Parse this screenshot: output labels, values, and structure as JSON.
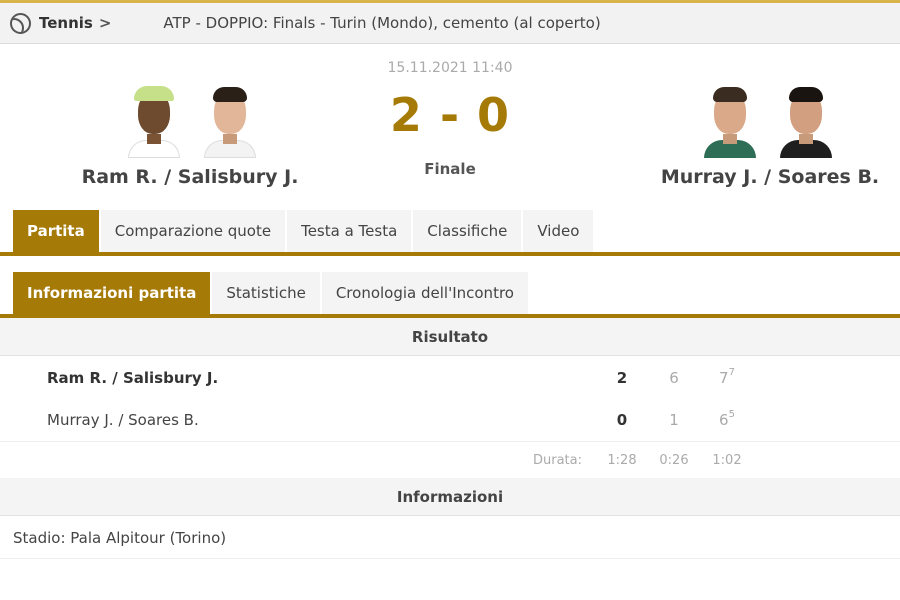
{
  "breadcrumb": {
    "sport": "Tennis",
    "separator": ">",
    "competition": "ATP - DOPPIO: Finals - Turin (Mondo), cemento (al coperto)",
    "sport_icon": "tennis-ball-icon",
    "category_icon": "doubles-people-icon"
  },
  "match": {
    "date": "15.11.2021 11:40",
    "score": "2 - 0",
    "status": "Finale",
    "home": {
      "name": "Ram R. / Salisbury J."
    },
    "away": {
      "name": "Murray J. / Soares B."
    }
  },
  "tabs": [
    "Partita",
    "Comparazione quote",
    "Testa a Testa",
    "Classifiche",
    "Video"
  ],
  "subtabs": [
    "Informazioni partita",
    "Statistiche",
    "Cronologia dell'Incontro"
  ],
  "result": {
    "header": "Risultato",
    "rows": [
      {
        "team": "Ram R. / Salisbury J.",
        "total": "2",
        "set1": "6",
        "set2": "7",
        "set2_tiebreak": "7"
      },
      {
        "team": "Murray J. / Soares B.",
        "total": "0",
        "set1": "1",
        "set2": "6",
        "set2_tiebreak": "5"
      }
    ],
    "duration_label": "Durata:",
    "durations": [
      "1:28",
      "0:26",
      "1:02"
    ]
  },
  "info": {
    "header": "Informazioni",
    "venue": "Stadio: Pala Alpitour (Torino)"
  },
  "colors": {
    "accent": "#a57a06",
    "topline": "#d9b44a",
    "icon_blue": "#3b7bd8"
  }
}
